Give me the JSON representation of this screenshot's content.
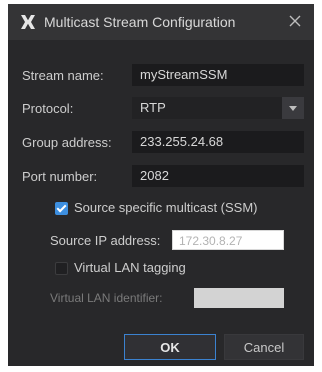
{
  "dialog": {
    "title": "Multicast Stream Configuration",
    "logo_icon": "x-logo-icon",
    "close_icon": "close-icon"
  },
  "form": {
    "stream_name_label": "Stream name:",
    "stream_name_value": "myStreamSSM",
    "protocol_label": "Protocol:",
    "protocol_value": "RTP",
    "group_address_label": "Group address:",
    "group_address_value": "233.255.24.68",
    "port_number_label": "Port number:",
    "port_number_value": "2082",
    "ssm_label": "Source specific multicast (SSM)",
    "ssm_checked": true,
    "source_ip_label": "Source IP address:",
    "source_ip_value": "172.30.8.27",
    "vlan_tagging_label": "Virtual LAN tagging",
    "vlan_tagging_checked": false,
    "vlan_id_label": "Virtual LAN identifier:",
    "vlan_id_value": ""
  },
  "buttons": {
    "ok_label": "OK",
    "cancel_label": "Cancel"
  },
  "colors": {
    "background": "#28282a",
    "titlebar": "#343436",
    "accent": "#3d8fe0"
  }
}
